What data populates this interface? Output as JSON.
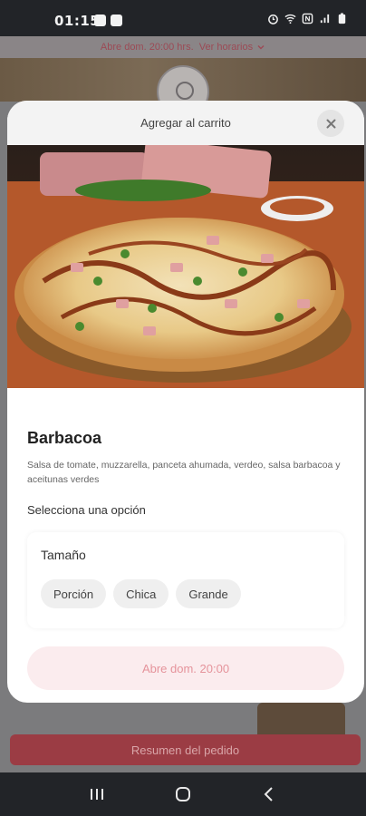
{
  "status_bar": {
    "time": "01:15",
    "left_icons": [
      "image-icon",
      "app-icon"
    ],
    "right_icons": [
      "alarm-icon",
      "wifi-icon",
      "nfc-icon",
      "signal-icon",
      "battery-icon"
    ]
  },
  "background": {
    "banner_text": "Abre dom. 20:00 hrs.",
    "banner_link": "Ver horarios",
    "summary_button": "Resumen del pedido"
  },
  "modal": {
    "title": "Agregar al carrito",
    "product": {
      "name": "Barbacoa",
      "description": "Salsa de tomate, muzzarella, panceta ahumada, verdeo, salsa barbacoa y aceitunas verdes"
    },
    "select_prompt": "Selecciona una opción",
    "option_group": {
      "title": "Tamaño",
      "options": [
        "Porción",
        "Chica",
        "Grande"
      ]
    },
    "cta_label": "Abre dom. 20:00"
  },
  "colors": {
    "accent": "#9b3c44",
    "cta_bg": "#fbecee",
    "cta_text": "#e5939b",
    "status_bar": "#222428"
  }
}
